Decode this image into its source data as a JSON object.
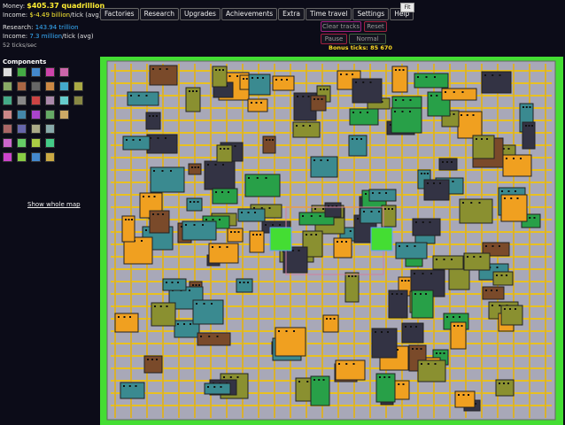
{
  "stats": {
    "money_label": "Money:",
    "money_value": "$405.37 quadrillion",
    "income_label": "Income:",
    "income_value": "$-4.49 billion",
    "income_suffix": "/tick (avg)",
    "research_label": "Research:",
    "research_value": "143.94 trillion",
    "research_income_label": "Income:",
    "research_income_value": "7.3 million",
    "research_income_suffix": "/tick (avg)",
    "ticks": "52 ticks/sec"
  },
  "menu": [
    "Factories",
    "Research",
    "Upgrades",
    "Achievements",
    "Extra",
    "Time travel",
    "Settings",
    "Help"
  ],
  "fit_label": "Fit",
  "controls": {
    "clear_tracks": "Clear tracks",
    "reset": "Reset",
    "pause": "Pause",
    "normal": "Normal",
    "bonus_label": "Bonus ticks:",
    "bonus_value": "85 670"
  },
  "components_title": "Components",
  "show_whole_map": "Show whole map",
  "palette_icons": [
    "pointer-icon",
    "conveyor-icon",
    "arrow-icon",
    "buyer-icon",
    "seller-icon",
    "mine-icon",
    "furnace-icon",
    "crusher-icon",
    "press-icon",
    "cutter-icon",
    "mixer-icon",
    "plant-icon",
    "lab-icon",
    "assembler-icon",
    "packer-icon",
    "sorter-icon",
    "garage-icon",
    "oven-icon",
    "tank-icon",
    "drill-icon",
    "factory-icon",
    "shop-icon",
    "smelter-icon",
    "grinder-icon",
    "welder-icon",
    "molder-icon",
    "bender-icon",
    "refinery-icon",
    "boiler-icon",
    "gear-icon",
    "battery-icon",
    "chip-icon",
    "engine-icon",
    "robot-icon"
  ],
  "colors": {
    "grass": "#44dd33",
    "floor": "#a8a8b8",
    "track": "#e8c020",
    "building_yellow": "#f0a020",
    "building_teal": "#3a8a90",
    "building_olive": "#8a9030",
    "building_brown": "#7a4a2a",
    "building_green": "#28a048",
    "building_pink": "#c878a0"
  }
}
